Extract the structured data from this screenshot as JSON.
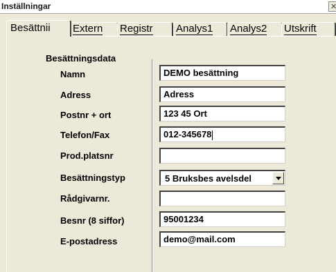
{
  "window": {
    "title": "Inställningar"
  },
  "tabs": [
    {
      "label": "Besättnii",
      "active": true
    },
    {
      "label": "Extern"
    },
    {
      "label": "Registr"
    },
    {
      "label": "Analys1"
    },
    {
      "label": "Analys2"
    },
    {
      "label": "Utskrift"
    }
  ],
  "group": {
    "label": "Besättningsdata"
  },
  "fields": {
    "namn": {
      "label": "Namn",
      "value": "DEMO besättning"
    },
    "adress": {
      "label": "Adress",
      "value": "Adress"
    },
    "postnr": {
      "label": "Postnr + ort",
      "value": "123 45 Ort"
    },
    "telefon": {
      "label": "Telefon/Fax",
      "value": "012-345678"
    },
    "prodplats": {
      "label": "Prod.platsnr",
      "value": ""
    },
    "typ": {
      "label": "Besättningstyp",
      "value": "5 Bruksbes avelsdel"
    },
    "radgivar": {
      "label": "Rådgivarnr.",
      "value": ""
    },
    "besnr": {
      "label": "Besnr (8 siffor)",
      "value": "95001234"
    },
    "epost": {
      "label": "E-postadress",
      "value": "demo@mail.com"
    }
  }
}
